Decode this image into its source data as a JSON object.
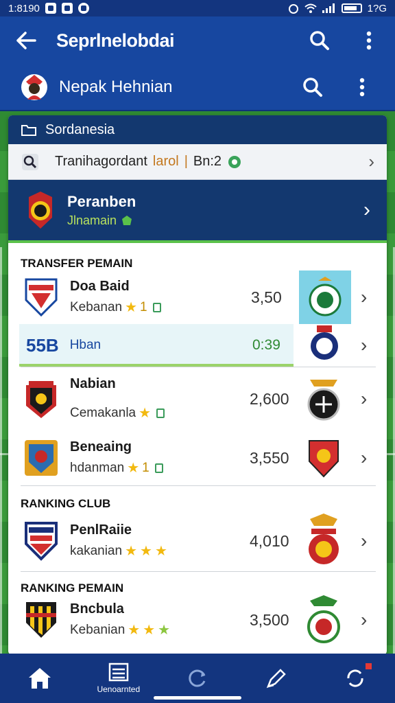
{
  "status_bar": {
    "time": "1:8190",
    "right_text": "1?G"
  },
  "app_bar": {
    "title": "Seprlnelobdai"
  },
  "sub_bar": {
    "name": "Nepak Hehnian"
  },
  "card": {
    "head_label": "Sordanesia",
    "search": {
      "text": "Tranihagordant",
      "accent": "larol",
      "separator": "|",
      "suffix": "Bn:2"
    },
    "banner": {
      "title": "Peranben",
      "subtitle": "Jlnamain"
    }
  },
  "sections": {
    "transfer": "TRANSFER PEMAIN",
    "ranking_club": "RANKING CLUB",
    "ranking_pemain": "RANKING PEMAIN"
  },
  "rows": [
    {
      "name": "Doa Baid",
      "sub": "Kebanan",
      "rating_num": "1",
      "value": "3,50"
    },
    {
      "name": "Nabian",
      "sub": "Cemakanla",
      "rating_num": "",
      "value": "2,600"
    },
    {
      "name": "Beneaing",
      "sub": "hdanman",
      "rating_num": "1",
      "value": "3,550"
    },
    {
      "name": "PenlRaiie",
      "sub": "kakanian",
      "rating_num": "",
      "value": "4,010"
    },
    {
      "name": "Bncbula",
      "sub": "Kebanian",
      "rating_num": "",
      "value": "3,500"
    }
  ],
  "highlight": {
    "big": "55B",
    "label": "Hban",
    "time": "0:39"
  },
  "bottom_nav": {
    "item2_label": "Uenoarnted"
  },
  "colors": {
    "primary": "#1747a0",
    "dark": "#13386f",
    "accent_green": "#5bc14a",
    "star": "#f2b90f"
  },
  "icons": [
    "back-arrow-icon",
    "search-icon",
    "more-vert-icon",
    "home-icon",
    "list-icon",
    "refresh-icon",
    "edit-icon",
    "sync-icon"
  ]
}
